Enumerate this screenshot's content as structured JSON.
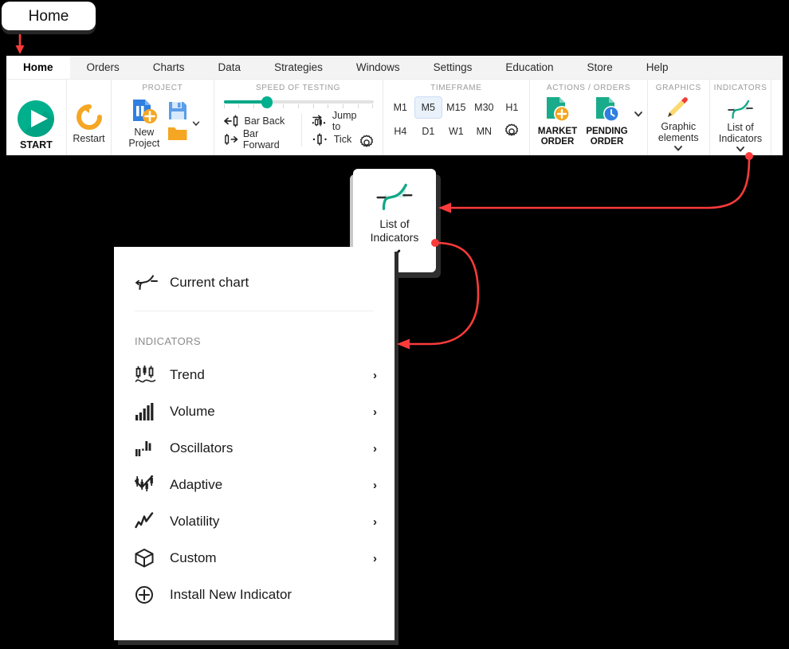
{
  "callout": {
    "label": "Home",
    "arrow_color": "#fb3b3b"
  },
  "ribbon": {
    "tabs": [
      {
        "label": "Home",
        "active": true
      },
      {
        "label": "Orders",
        "active": false
      },
      {
        "label": "Charts",
        "active": false
      },
      {
        "label": "Data",
        "active": false
      },
      {
        "label": "Strategies",
        "active": false
      },
      {
        "label": "Windows",
        "active": false
      },
      {
        "label": "Settings",
        "active": false
      },
      {
        "label": "Education",
        "active": false
      },
      {
        "label": "Store",
        "active": false
      },
      {
        "label": "Help",
        "active": false
      }
    ],
    "start": {
      "label": "START",
      "icon": "play-icon",
      "color": "#00b08d"
    },
    "restart": {
      "label": "Restart",
      "icon": "restart-icon",
      "color": "#f5a623"
    },
    "project": {
      "title": "PROJECT",
      "new_project_label": "New\nProject",
      "new_project_line1": "New",
      "new_project_line2": "Project",
      "save_icon": "floppy-save-icon",
      "open_icon": "folder-open-icon",
      "more_icon": "chevron-down-icon"
    },
    "speed": {
      "title": "SPEED OF TESTING",
      "slider_value": 28,
      "slider_min": 0,
      "slider_max": 100,
      "bar_back": "Bar Back",
      "bar_forward": "Bar Forward",
      "jump_to": "Jump to",
      "tick": "Tick",
      "settings_icon": "gear-icon"
    },
    "timeframe": {
      "title": "TIMEFRAME",
      "row1": [
        "M1",
        "M5",
        "M15",
        "M30",
        "H1"
      ],
      "row2": [
        "H4",
        "D1",
        "W1",
        "MN"
      ],
      "selected": "M5",
      "settings_icon": "gear-icon"
    },
    "actions": {
      "title": "ACTIONS  /  ORDERS",
      "market_order_line1": "MARKET",
      "market_order_line2": "ORDER",
      "pending_order_line1": "PENDING",
      "pending_order_line2": "ORDER",
      "more_icon": "chevron-down-icon"
    },
    "graphics": {
      "title": "GRAPHICS",
      "label_line1": "Graphic",
      "label_line2": "elements",
      "icon": "pencil-icon",
      "more_icon": "chevron-down-icon"
    },
    "indicators": {
      "title": "INDICATORS",
      "label_line1": "List of",
      "label_line2": "Indicators",
      "icon": "indicator-curve-icon",
      "more_icon": "chevron-down-icon"
    }
  },
  "float_card": {
    "label_line1": "List of",
    "label_line2": "Indicators",
    "icon": "indicator-curve-icon",
    "more_icon": "chevron-down-icon"
  },
  "menu": {
    "current_chart": {
      "label": "Current chart",
      "icon": "current-chart-icon"
    },
    "section_header": "INDICATORS",
    "items": [
      {
        "label": "Trend",
        "icon": "trend-icon",
        "chevron": "›"
      },
      {
        "label": "Volume",
        "icon": "volume-icon",
        "chevron": "›"
      },
      {
        "label": "Oscillators",
        "icon": "oscillators-icon",
        "chevron": "›"
      },
      {
        "label": "Adaptive",
        "icon": "adaptive-icon",
        "chevron": "›"
      },
      {
        "label": "Volatility",
        "icon": "volatility-icon",
        "chevron": "›"
      },
      {
        "label": "Custom",
        "icon": "custom-box-icon",
        "chevron": "›"
      }
    ],
    "install": {
      "label": "Install New Indicator",
      "icon": "plus-circle-icon"
    }
  },
  "annotations": {
    "arrow_color": "#fb3b3b",
    "arrow_1": "ribbon-indicators-to-card",
    "arrow_2": "card-to-menu",
    "arrow_3": "callout-to-home-tab"
  }
}
